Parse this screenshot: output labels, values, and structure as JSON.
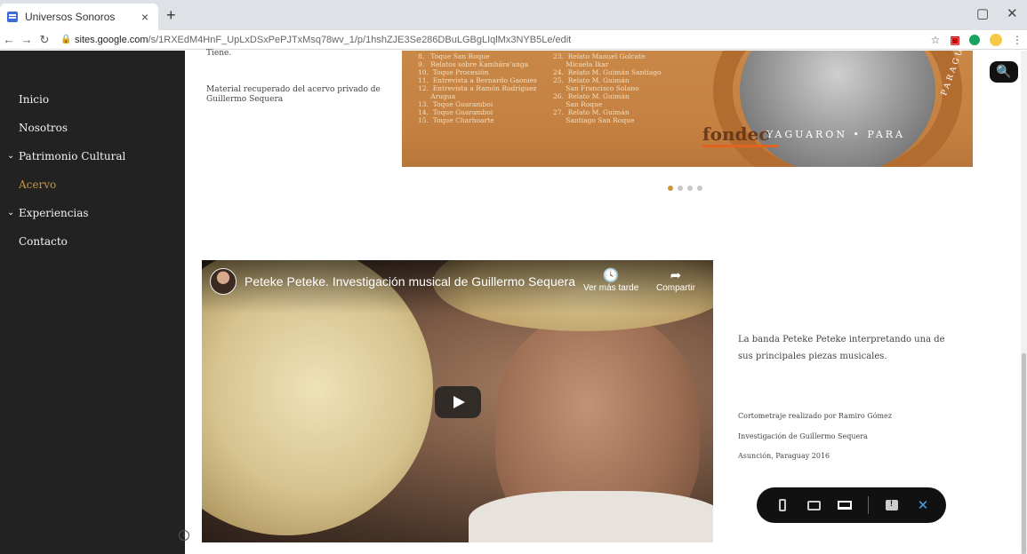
{
  "browser": {
    "tab_title": "Universos Sonoros",
    "tab_close": "×",
    "new_tab": "+",
    "minimize": "▢",
    "close": "✕",
    "url_host": "sites.google.com",
    "url_path": "/s/1RXEdM4HnF_UpLxDSxPePJTxMsq78wv_1/p/1hshZJE3Se286DBuLGBgLIqlMx3NYB5Le/edit",
    "star_icon": "☆",
    "menu_icon": "⋮"
  },
  "sidebar": {
    "items": [
      {
        "label": "Inicio"
      },
      {
        "label": "Nosotros"
      },
      {
        "label": "Patrimonio Cultural"
      },
      {
        "label": "Acervo"
      },
      {
        "label": "Experiencias"
      },
      {
        "label": "Contacto"
      }
    ]
  },
  "content": {
    "top_caption_line1": "Tiene.",
    "material_caption": "Material recuperado del acervo privado de",
    "material_caption_2": "Guillermo Sequera",
    "cd_list_left": "8.   Toque San Roque\n9.   Relatos sobre Kambára’anga\n10.  Toque Procesión\n11.  Entrevista a Bernardo Gaonies\n12.  Entrevista a Ramón Rodríguez\n      Arugua\n13.  Toque Guaramboi\n14.  Toque Guaramboi\n15.  Toque Charhoarte",
    "cd_list_right": "23.  Relato Manuel Golcate\n      Micaela Ikar\n24.  Relato M. Guimán Santiago\n25.  Relato M. Guimán\n      San Francisco Solano\n26.  Relato M. Guimán\n      San Roque\n27.  Relato M. Guimán\n      Santiago San Roque",
    "cd_logo": "fondec",
    "cd_ring_bottom": "YAGUARON  •  PARA",
    "cd_ring_side": "PARAGUAY",
    "carousel_dots": 4,
    "carousel_active": 0
  },
  "video": {
    "title": "Peteke Peteke. Investigación musical de Guillermo Sequera",
    "watch_later_icon": "🕓",
    "watch_later": "Ver más tarde",
    "share_icon": "➦",
    "share": "Compartir"
  },
  "description": {
    "main": "La banda Peteke Peteke interpretando una de sus principales piezas musicales.",
    "credit1": "Cortometraje realizado por Ramiro Gómez",
    "credit2": "Investigación de Guillermo Sequera",
    "credit3": "Asunción, Paraguay 2016"
  },
  "toolbar": {
    "close_icon": "✕"
  },
  "search": {
    "icon": "🔍"
  }
}
